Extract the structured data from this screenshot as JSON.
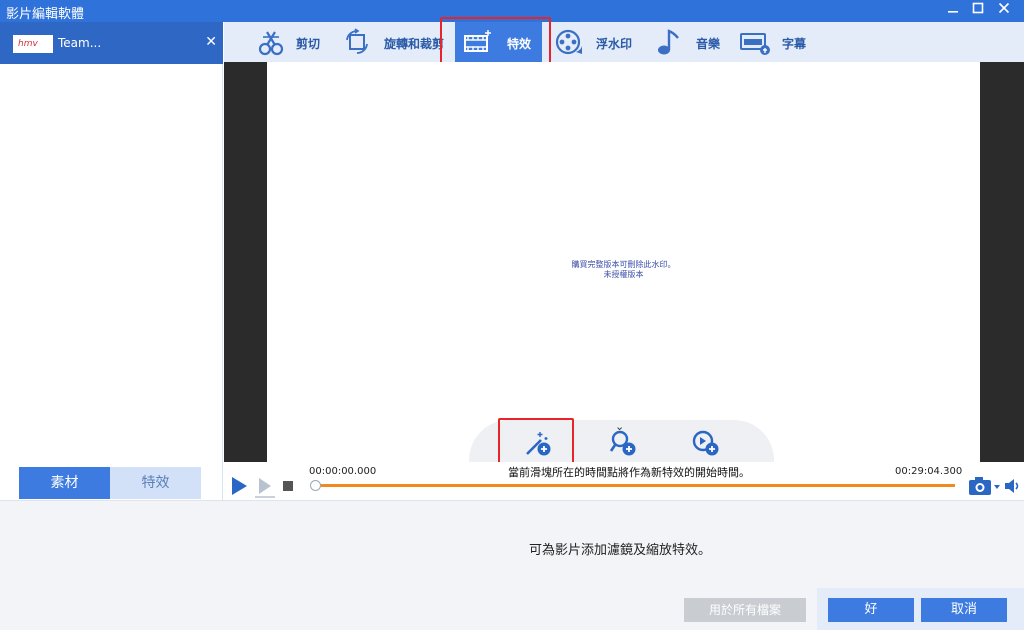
{
  "window": {
    "title": "影片編輯軟體"
  },
  "file_tab": {
    "thumb_text": "hmv",
    "name": "Team..."
  },
  "left_tabs": {
    "media": "素材",
    "effects": "特效"
  },
  "toolbar": {
    "items": [
      {
        "label": "剪切",
        "icon": "scissors-icon"
      },
      {
        "label": "旋轉和裁剪",
        "icon": "rotate-crop-icon"
      },
      {
        "label": "特效",
        "icon": "film-sparkle-icon",
        "selected": true
      },
      {
        "label": "浮水印",
        "icon": "film-reel-icon"
      },
      {
        "label": "音樂",
        "icon": "music-note-icon"
      },
      {
        "label": "字幕",
        "icon": "subtitle-icon"
      }
    ]
  },
  "preview": {
    "watermark_line1": "購買完整版本可刪除此水印。",
    "watermark_line2": "未授權版本"
  },
  "timeline": {
    "start_time": "00:00:00.000",
    "end_time": "00:29:04.300",
    "message": "當前滑塊所在的時間點將作為新特效的開始時間。",
    "position": 0
  },
  "hint_text": "可為影片添加濾鏡及縮放特效。",
  "buttons": {
    "apply_all": "用於所有檔案",
    "ok": "好",
    "cancel": "取消"
  },
  "colors": {
    "accent": "#3d7be0",
    "titlebar": "#2f72d9",
    "highlight": "#e8242b",
    "track": "#f08a1c"
  }
}
